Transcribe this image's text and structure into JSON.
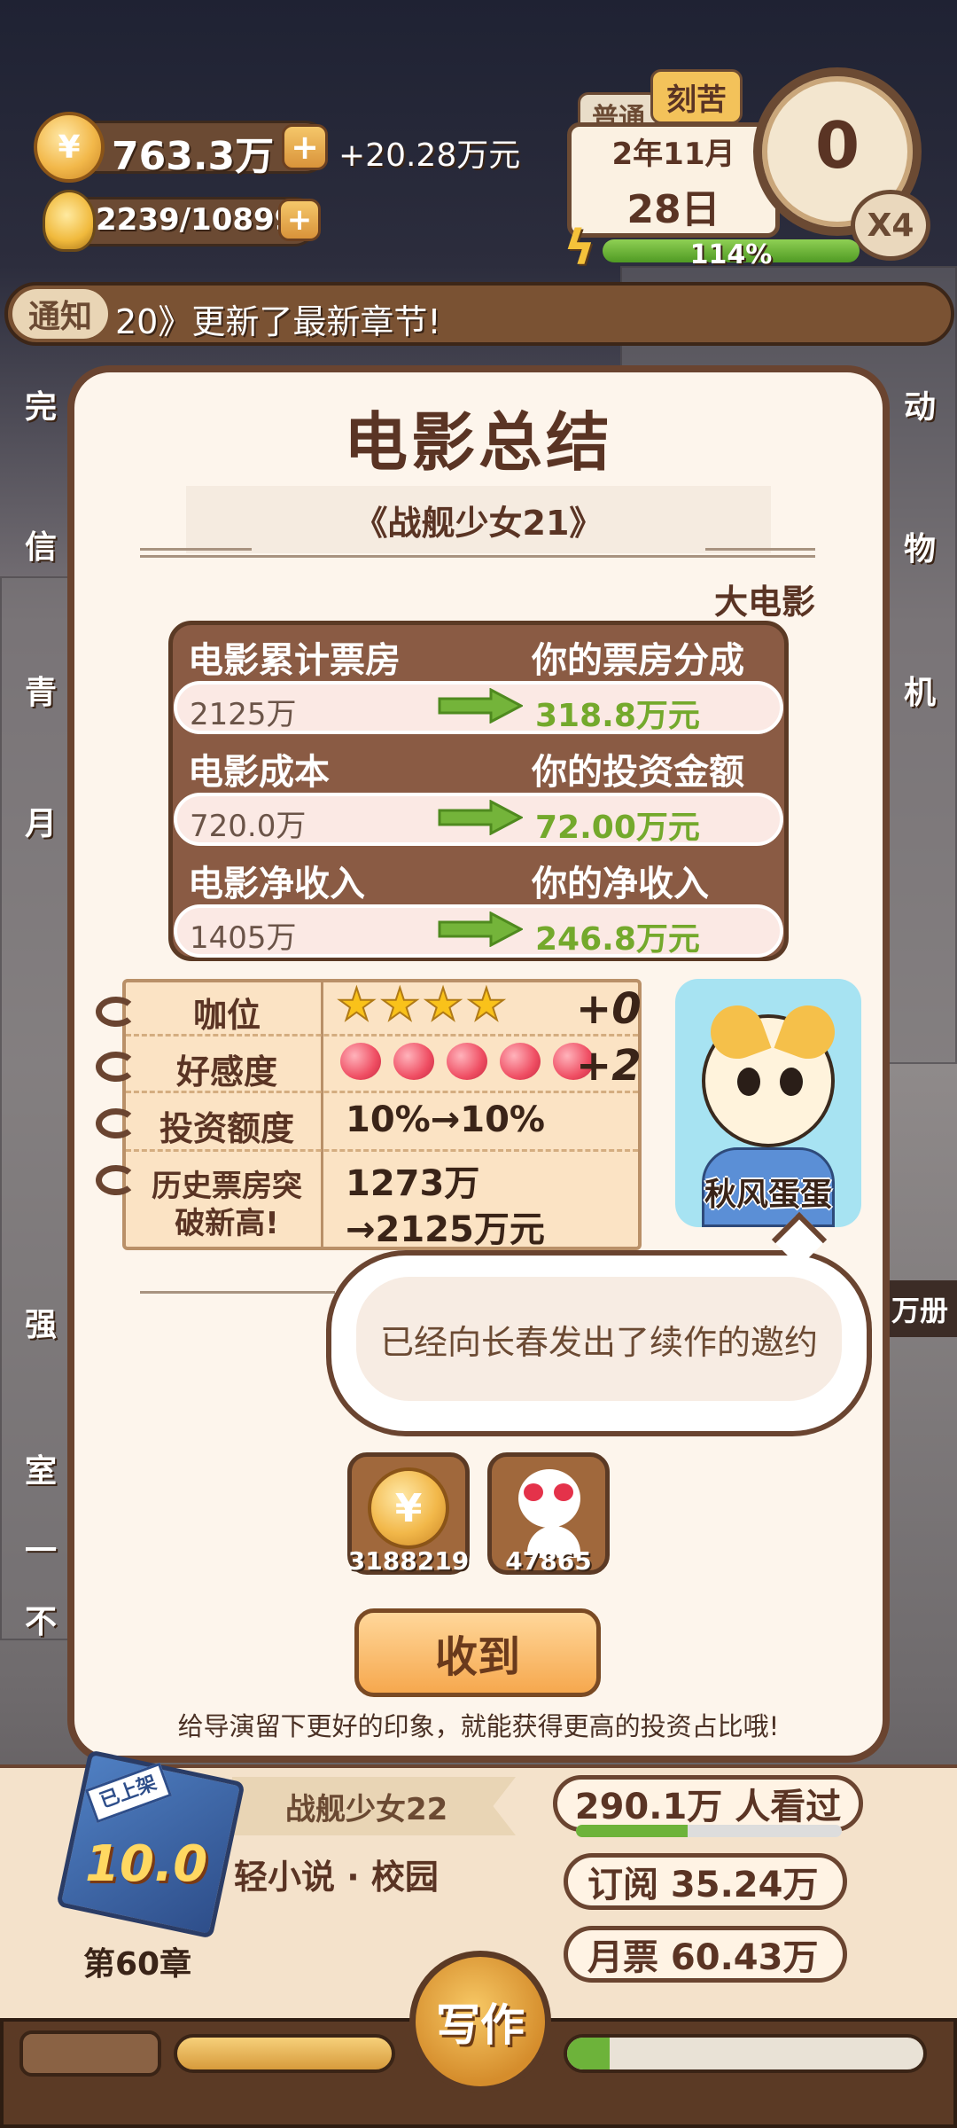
{
  "hud": {
    "money": "763.3万",
    "money_income": "+20.28万元",
    "inspiration": "2239/10899",
    "date_mode_normal": "普通",
    "date_mode_hard": "刻苦",
    "date_month": "2年11月",
    "date_day": "28日",
    "clock_value": "0",
    "speed": "X4",
    "energy_percent_label": "114%",
    "energy_fill": 1.0
  },
  "notice": {
    "tag": "通知",
    "text": "20》更新了最新章节!"
  },
  "modal": {
    "title": "电影总结",
    "movie_name": "《战舰少女21》",
    "category": "大电影",
    "rows": [
      {
        "left_label": "电影累计票房",
        "right_label": "你的票房分成",
        "left_value": "2125万",
        "right_value": "318.8万元"
      },
      {
        "left_label": "电影成本",
        "right_label": "你的投资金额",
        "left_value": "720.0万",
        "right_value": "72.00万元"
      },
      {
        "left_label": "电影净收入",
        "right_label": "你的净收入",
        "left_value": "1405万",
        "right_value": "246.8万元"
      }
    ],
    "stats": {
      "rank_label": "咖位",
      "rank_stars": 4,
      "rank_delta": "+0",
      "affinity_label": "好感度",
      "affinity_hearts": 5,
      "affinity_delta": "+2",
      "invest_label": "投资额度",
      "invest_value": "10%→10%",
      "record_label_1": "历史票房突",
      "record_label_2": "破新高!",
      "record_value_1": "1273万",
      "record_value_2": "→2125万元"
    },
    "director_name": "秋风蛋蛋",
    "speech": "已经向长春发出了续作的邀约",
    "rewards": [
      {
        "icon": "coin-reward-icon",
        "amount": "3188219"
      },
      {
        "icon": "fan-reward-icon",
        "amount": "47865"
      }
    ],
    "confirm_label": "收到",
    "tip": "给导演留下更好的印象，就能获得更高的投资占比哦!"
  },
  "book": {
    "title": "战舰少女22",
    "genre": "轻小说 · 校园",
    "score": "10.0",
    "status_tag": "已上架",
    "chapter": "第60章",
    "viewers": "290.1万 人看过",
    "subs": "订阅 35.24万",
    "monthly": "月票 60.43万",
    "write_label": "写作"
  },
  "side": {
    "left_labels": [
      "完",
      "信",
      "青",
      "月",
      "强",
      "室",
      "一",
      "不"
    ],
    "right_labels": [
      "动",
      "物",
      "机"
    ],
    "right_wan": "万册"
  },
  "colors": {
    "accent_brown": "#6a4430",
    "green": "#74a92c"
  }
}
